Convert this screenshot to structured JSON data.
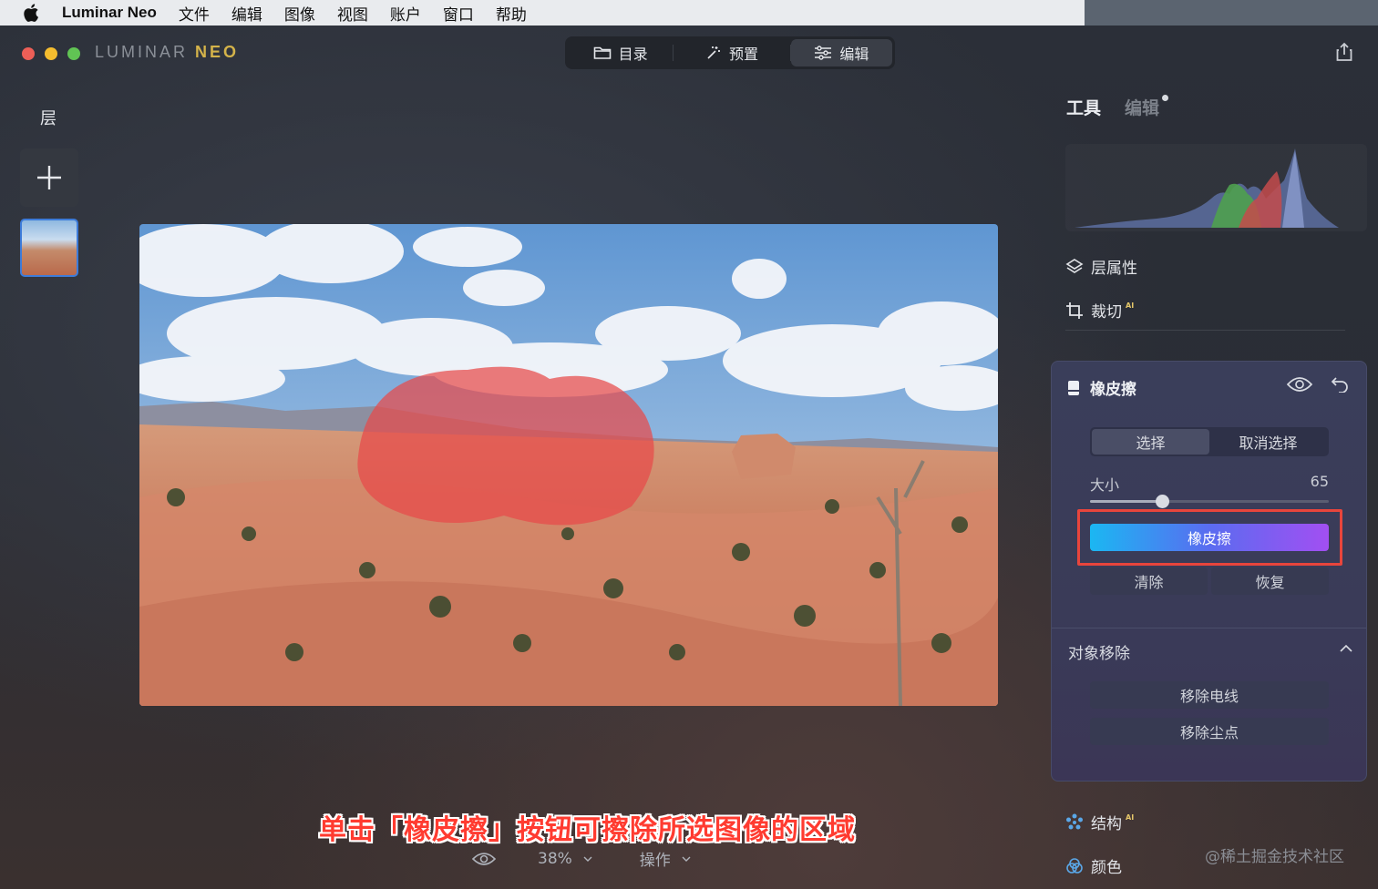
{
  "menubar": {
    "app_name": "Luminar Neo",
    "items": [
      "文件",
      "编辑",
      "图像",
      "视图",
      "账户",
      "窗口",
      "帮助"
    ]
  },
  "window": {
    "brand_left": "LUMINAR",
    "brand_right": "NEO"
  },
  "tabs": [
    {
      "label": "目录",
      "icon": "folder-icon"
    },
    {
      "label": "预置",
      "icon": "magic-wand-icon"
    },
    {
      "label": "编辑",
      "icon": "sliders-icon",
      "active": true
    }
  ],
  "layers": {
    "title": "层"
  },
  "canvas": {
    "caption": "单击「橡皮擦」按钮可擦除所选图像的区域",
    "zoom": "38%",
    "ops": "操作"
  },
  "right_panel": {
    "tab_tools": "工具",
    "tab_edits": "编辑",
    "layer_props": "层属性",
    "crop": "裁切",
    "crop_ai": "AI",
    "eraser": {
      "title": "橡皮擦",
      "select": "选择",
      "deselect": "取消选择",
      "size_label": "大小",
      "size_value": "65",
      "size_fraction": 0.3,
      "erase_button": "橡皮擦",
      "clear": "清除",
      "restore": "恢复"
    },
    "object_removal": {
      "title": "对象移除",
      "remove_wires": "移除电线",
      "remove_dust": "移除尘点"
    },
    "structure": "结构",
    "structure_ai": "AI",
    "color": "颜色"
  },
  "watermark": "@稀土掘金技术社区",
  "colors": {
    "accent_blue": "#3d7bd9",
    "erase_gradient_start": "#1bb7f2",
    "erase_gradient_end": "#a24ff2",
    "highlight_red": "#e8453c",
    "mask_red": "#e84a4a"
  }
}
